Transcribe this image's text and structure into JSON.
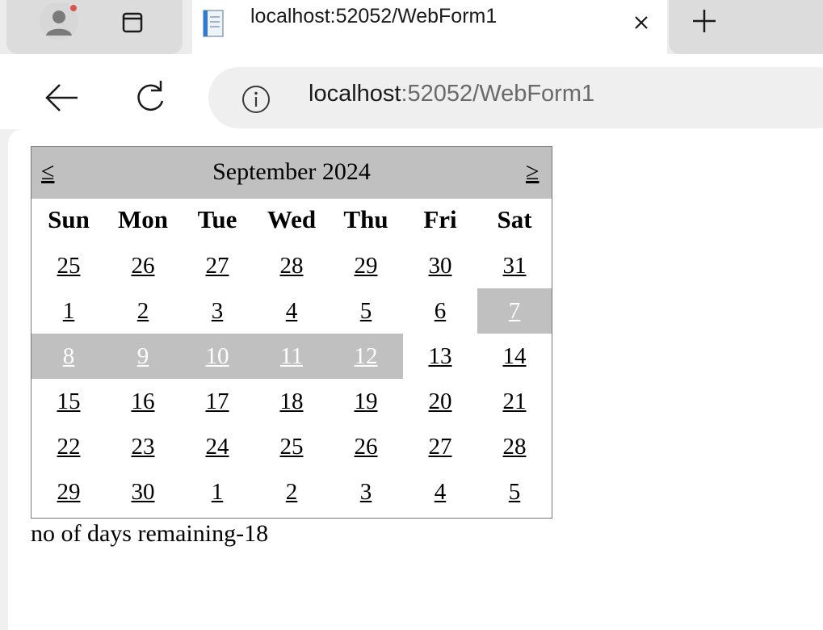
{
  "browser": {
    "tab": {
      "title": "localhost:52052/WebForm1",
      "close": "×"
    },
    "new_tab": "+",
    "address": {
      "host": "localhost",
      "rest": ":52052/WebForm1"
    }
  },
  "calendar": {
    "prev": "≤",
    "next": "≥",
    "title": "September 2024",
    "days_of_week": [
      "Sun",
      "Mon",
      "Tue",
      "Wed",
      "Thu",
      "Fri",
      "Sat"
    ],
    "weeks": [
      [
        "25",
        "26",
        "27",
        "28",
        "29",
        "30",
        "31"
      ],
      [
        "1",
        "2",
        "3",
        "4",
        "5",
        "6",
        "7"
      ],
      [
        "8",
        "9",
        "10",
        "11",
        "12",
        "13",
        "14"
      ],
      [
        "15",
        "16",
        "17",
        "18",
        "19",
        "20",
        "21"
      ],
      [
        "22",
        "23",
        "24",
        "25",
        "26",
        "27",
        "28"
      ],
      [
        "29",
        "30",
        "1",
        "2",
        "3",
        "4",
        "5"
      ]
    ],
    "selected_days": [
      "7",
      "8",
      "9",
      "10",
      "11",
      "12"
    ],
    "selected_color": "#c0c0c0"
  },
  "status": {
    "text": "no of days remaining-18"
  }
}
